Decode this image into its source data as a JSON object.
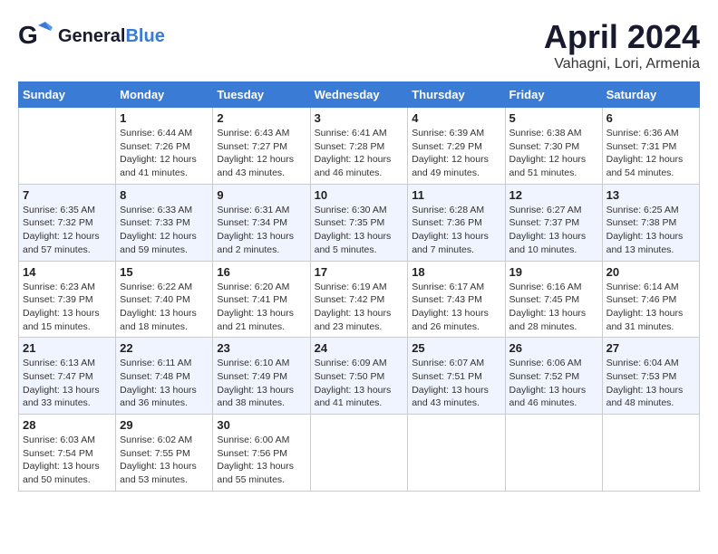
{
  "header": {
    "logo_general": "General",
    "logo_blue": "Blue",
    "month": "April 2024",
    "location": "Vahagni, Lori, Armenia"
  },
  "weekdays": [
    "Sunday",
    "Monday",
    "Tuesday",
    "Wednesday",
    "Thursday",
    "Friday",
    "Saturday"
  ],
  "weeks": [
    [
      {
        "day": "",
        "info": ""
      },
      {
        "day": "1",
        "info": "Sunrise: 6:44 AM\nSunset: 7:26 PM\nDaylight: 12 hours\nand 41 minutes."
      },
      {
        "day": "2",
        "info": "Sunrise: 6:43 AM\nSunset: 7:27 PM\nDaylight: 12 hours\nand 43 minutes."
      },
      {
        "day": "3",
        "info": "Sunrise: 6:41 AM\nSunset: 7:28 PM\nDaylight: 12 hours\nand 46 minutes."
      },
      {
        "day": "4",
        "info": "Sunrise: 6:39 AM\nSunset: 7:29 PM\nDaylight: 12 hours\nand 49 minutes."
      },
      {
        "day": "5",
        "info": "Sunrise: 6:38 AM\nSunset: 7:30 PM\nDaylight: 12 hours\nand 51 minutes."
      },
      {
        "day": "6",
        "info": "Sunrise: 6:36 AM\nSunset: 7:31 PM\nDaylight: 12 hours\nand 54 minutes."
      }
    ],
    [
      {
        "day": "7",
        "info": "Sunrise: 6:35 AM\nSunset: 7:32 PM\nDaylight: 12 hours\nand 57 minutes."
      },
      {
        "day": "8",
        "info": "Sunrise: 6:33 AM\nSunset: 7:33 PM\nDaylight: 12 hours\nand 59 minutes."
      },
      {
        "day": "9",
        "info": "Sunrise: 6:31 AM\nSunset: 7:34 PM\nDaylight: 13 hours\nand 2 minutes."
      },
      {
        "day": "10",
        "info": "Sunrise: 6:30 AM\nSunset: 7:35 PM\nDaylight: 13 hours\nand 5 minutes."
      },
      {
        "day": "11",
        "info": "Sunrise: 6:28 AM\nSunset: 7:36 PM\nDaylight: 13 hours\nand 7 minutes."
      },
      {
        "day": "12",
        "info": "Sunrise: 6:27 AM\nSunset: 7:37 PM\nDaylight: 13 hours\nand 10 minutes."
      },
      {
        "day": "13",
        "info": "Sunrise: 6:25 AM\nSunset: 7:38 PM\nDaylight: 13 hours\nand 13 minutes."
      }
    ],
    [
      {
        "day": "14",
        "info": "Sunrise: 6:23 AM\nSunset: 7:39 PM\nDaylight: 13 hours\nand 15 minutes."
      },
      {
        "day": "15",
        "info": "Sunrise: 6:22 AM\nSunset: 7:40 PM\nDaylight: 13 hours\nand 18 minutes."
      },
      {
        "day": "16",
        "info": "Sunrise: 6:20 AM\nSunset: 7:41 PM\nDaylight: 13 hours\nand 21 minutes."
      },
      {
        "day": "17",
        "info": "Sunrise: 6:19 AM\nSunset: 7:42 PM\nDaylight: 13 hours\nand 23 minutes."
      },
      {
        "day": "18",
        "info": "Sunrise: 6:17 AM\nSunset: 7:43 PM\nDaylight: 13 hours\nand 26 minutes."
      },
      {
        "day": "19",
        "info": "Sunrise: 6:16 AM\nSunset: 7:45 PM\nDaylight: 13 hours\nand 28 minutes."
      },
      {
        "day": "20",
        "info": "Sunrise: 6:14 AM\nSunset: 7:46 PM\nDaylight: 13 hours\nand 31 minutes."
      }
    ],
    [
      {
        "day": "21",
        "info": "Sunrise: 6:13 AM\nSunset: 7:47 PM\nDaylight: 13 hours\nand 33 minutes."
      },
      {
        "day": "22",
        "info": "Sunrise: 6:11 AM\nSunset: 7:48 PM\nDaylight: 13 hours\nand 36 minutes."
      },
      {
        "day": "23",
        "info": "Sunrise: 6:10 AM\nSunset: 7:49 PM\nDaylight: 13 hours\nand 38 minutes."
      },
      {
        "day": "24",
        "info": "Sunrise: 6:09 AM\nSunset: 7:50 PM\nDaylight: 13 hours\nand 41 minutes."
      },
      {
        "day": "25",
        "info": "Sunrise: 6:07 AM\nSunset: 7:51 PM\nDaylight: 13 hours\nand 43 minutes."
      },
      {
        "day": "26",
        "info": "Sunrise: 6:06 AM\nSunset: 7:52 PM\nDaylight: 13 hours\nand 46 minutes."
      },
      {
        "day": "27",
        "info": "Sunrise: 6:04 AM\nSunset: 7:53 PM\nDaylight: 13 hours\nand 48 minutes."
      }
    ],
    [
      {
        "day": "28",
        "info": "Sunrise: 6:03 AM\nSunset: 7:54 PM\nDaylight: 13 hours\nand 50 minutes."
      },
      {
        "day": "29",
        "info": "Sunrise: 6:02 AM\nSunset: 7:55 PM\nDaylight: 13 hours\nand 53 minutes."
      },
      {
        "day": "30",
        "info": "Sunrise: 6:00 AM\nSunset: 7:56 PM\nDaylight: 13 hours\nand 55 minutes."
      },
      {
        "day": "",
        "info": ""
      },
      {
        "day": "",
        "info": ""
      },
      {
        "day": "",
        "info": ""
      },
      {
        "day": "",
        "info": ""
      }
    ]
  ]
}
